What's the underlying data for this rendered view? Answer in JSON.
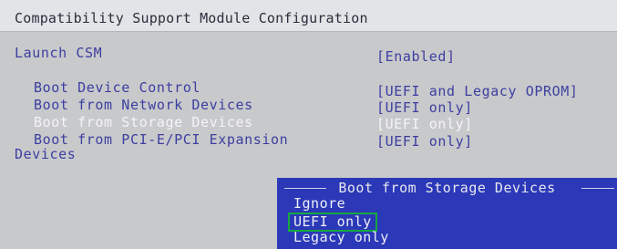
{
  "header": {
    "title": "Compatibility Support Module Configuration"
  },
  "settings": {
    "launch_csm": {
      "label": "Launch CSM",
      "value": "[Enabled]"
    },
    "boot_device_control": {
      "label": "Boot Device Control",
      "value": "[UEFI and Legacy OPROM]"
    },
    "boot_network": {
      "label": "Boot from Network Devices",
      "value": "[UEFI only]"
    },
    "boot_storage": {
      "label": "Boot from Storage Devices",
      "value": "[UEFI only]"
    },
    "boot_pcie": {
      "label": "Boot from PCI-E/PCI Expansion",
      "label_cont": "Devices",
      "value": "[UEFI only]"
    }
  },
  "popup": {
    "title": "Boot from Storage Devices",
    "options": [
      "Ignore",
      "UEFI only",
      "Legacy only"
    ],
    "selected": "UEFI only"
  },
  "colors": {
    "item_text": "#3c3fa0",
    "highlight_text": "#f4f4f6",
    "popup_bg": "#2b38b8",
    "selection_box": "#17a840"
  }
}
